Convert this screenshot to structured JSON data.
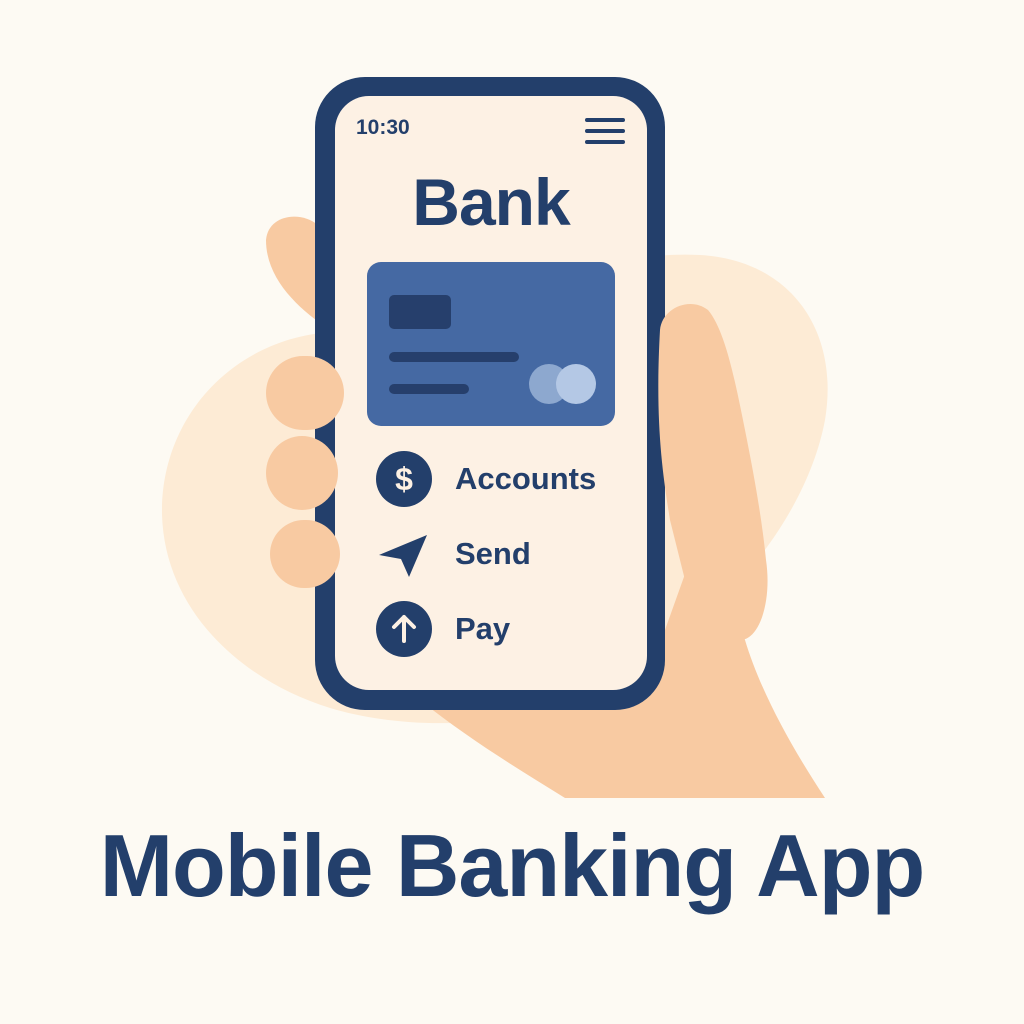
{
  "phone": {
    "status_time": "10:30",
    "menu_icon": "hamburger-menu-icon",
    "app_title": "Bank",
    "card": {
      "icon": "credit-card-icon"
    },
    "menu_items": [
      {
        "label": "Accounts",
        "icon": "dollar-icon"
      },
      {
        "label": "Send",
        "icon": "send-arrow-icon"
      },
      {
        "label": "Pay",
        "icon": "up-arrow-icon"
      }
    ]
  },
  "caption": "Mobile Banking App",
  "colors": {
    "navy": "#233f6b",
    "card_blue": "#4569a3",
    "screen_bg": "#fdf1e4",
    "skin": "#f8caa2",
    "blob": "#fdebd5",
    "page_bg": "#fdfaf3"
  }
}
